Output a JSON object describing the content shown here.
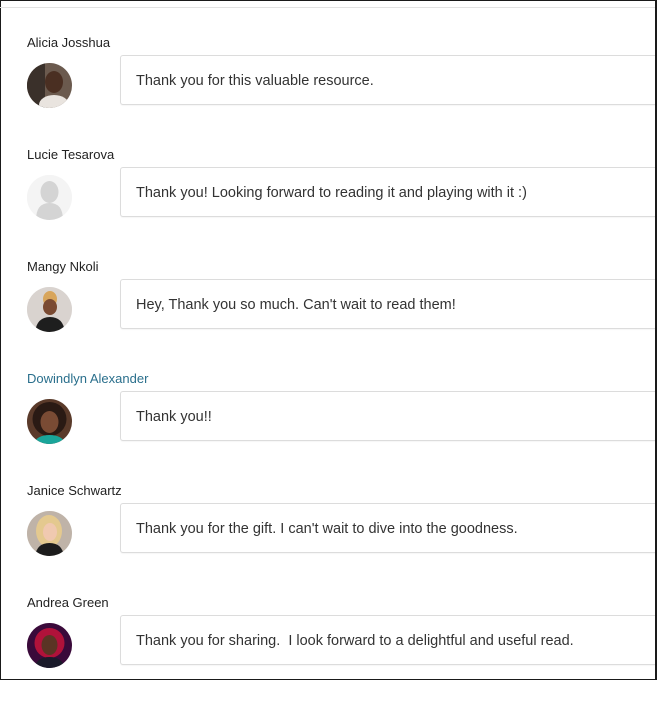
{
  "comments": [
    {
      "author": "Alicia Josshua",
      "text": "Thank you for this valuable resource.",
      "author_link": false,
      "avatar": "photo"
    },
    {
      "author": "Lucie Tesarova",
      "text": "Thank you! Looking forward to reading it and playing with it :)",
      "author_link": false,
      "avatar": "default-silhouette"
    },
    {
      "author": "Mangy Nkoli",
      "text": "Hey, Thank you so much. Can't wait to read them!",
      "author_link": false,
      "avatar": "photo"
    },
    {
      "author": "Dowindlyn Alexander",
      "text": "Thank you!!",
      "author_link": true,
      "avatar": "photo"
    },
    {
      "author": "Janice Schwartz",
      "text": "Thank you for the gift. I can't wait to dive into the goodness.",
      "author_link": false,
      "avatar": "photo"
    },
    {
      "author": "Andrea Green",
      "text": "Thank you for sharing.  I look forward to a delightful and useful read.",
      "author_link": false,
      "avatar": "photo"
    }
  ],
  "colors": {
    "author_link": "#2a6f8c",
    "text": "#333333",
    "border": "#dcdcdc"
  }
}
